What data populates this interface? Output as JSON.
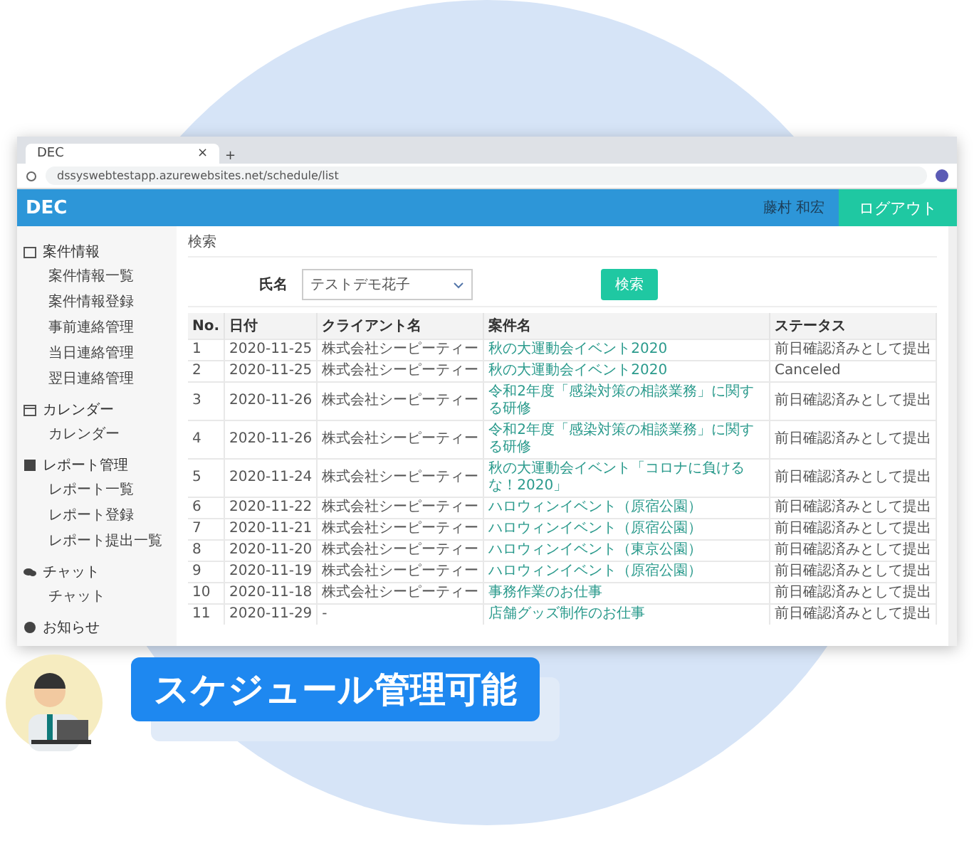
{
  "browser": {
    "tab_title": "DEC",
    "tab_close": "×",
    "new_tab": "+",
    "url": "dssyswebtestapp.azurewebsites.net/schedule/list"
  },
  "header": {
    "logo": "DEC",
    "user": "藤村 和宏",
    "logout": "ログアウト"
  },
  "sidebar": [
    {
      "label": "案件情報",
      "children": [
        {
          "label": "案件情報一覧"
        },
        {
          "label": "案件情報登録"
        },
        {
          "label": "事前連絡管理"
        },
        {
          "label": "当日連絡管理"
        },
        {
          "label": "翌日連絡管理"
        }
      ]
    },
    {
      "label": "カレンダー",
      "children": [
        {
          "label": "カレンダー"
        }
      ]
    },
    {
      "label": "レポート管理",
      "children": [
        {
          "label": "レポート一覧"
        },
        {
          "label": "レポート登録"
        },
        {
          "label": "レポート提出一覧"
        }
      ]
    },
    {
      "label": "チャット",
      "children": [
        {
          "label": "チャット"
        }
      ]
    },
    {
      "label": "お知らせ"
    }
  ],
  "breadcrumb": "検索",
  "search": {
    "label": "氏名",
    "value": "テストデモ花子",
    "button": "検索"
  },
  "table": {
    "columns": [
      "No.",
      "日付",
      "クライアント名",
      "案件名",
      "ステータス"
    ],
    "rows": [
      [
        "1",
        "2020-11-25",
        "株式会社シーピーティー",
        "秋の大運動会イベント2020",
        "前日確認済みとして提出"
      ],
      [
        "2",
        "2020-11-25",
        "株式会社シーピーティー",
        "秋の大運動会イベント2020",
        "Canceled"
      ],
      [
        "3",
        "2020-11-26",
        "株式会社シーピーティー",
        "令和2年度「感染対策の相談業務」に関する研修",
        "前日確認済みとして提出"
      ],
      [
        "4",
        "2020-11-26",
        "株式会社シーピーティー",
        "令和2年度「感染対策の相談業務」に関する研修",
        "前日確認済みとして提出"
      ],
      [
        "5",
        "2020-11-24",
        "株式会社シーピーティー",
        "秋の大運動会イベント「コロナに負けるな！2020」",
        "前日確認済みとして提出"
      ],
      [
        "6",
        "2020-11-22",
        "株式会社シーピーティー",
        "ハロウィンイベント（原宿公園）",
        "前日確認済みとして提出"
      ],
      [
        "7",
        "2020-11-21",
        "株式会社シーピーティー",
        "ハロウィンイベント（原宿公園）",
        "前日確認済みとして提出"
      ],
      [
        "8",
        "2020-11-20",
        "株式会社シーピーティー",
        "ハロウィンイベント（東京公園）",
        "前日確認済みとして提出"
      ],
      [
        "9",
        "2020-11-19",
        "株式会社シーピーティー",
        "ハロウィンイベント（原宿公園）",
        "前日確認済みとして提出"
      ],
      [
        "10",
        "2020-11-18",
        "株式会社シーピーティー",
        "事務作業のお仕事",
        "前日確認済みとして提出"
      ],
      [
        "11",
        "2020-11-29",
        "-",
        "店舗グッズ制作のお仕事",
        "前日確認済みとして提出"
      ]
    ]
  },
  "callout": "スケジュール管理可能"
}
